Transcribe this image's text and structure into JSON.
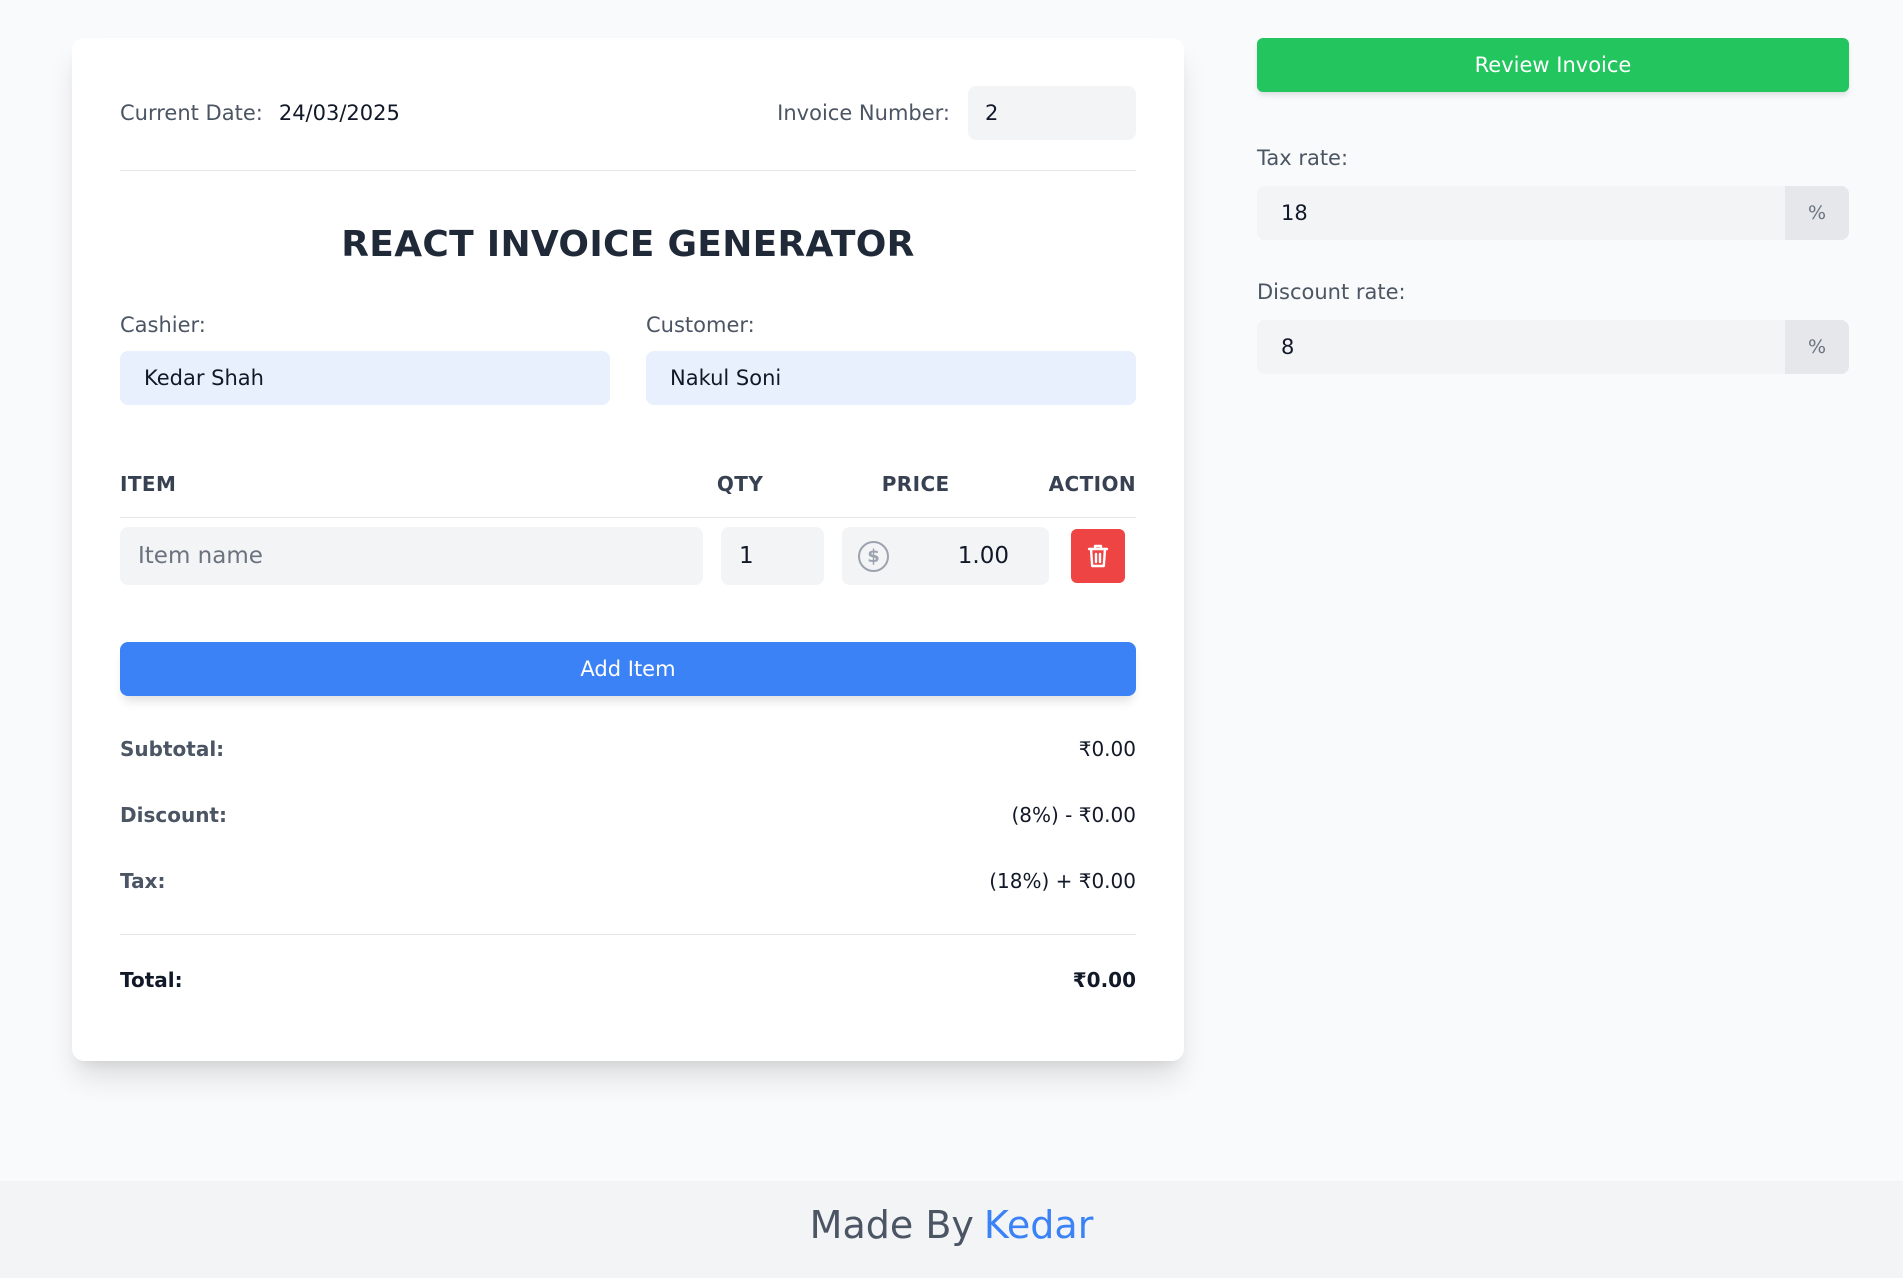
{
  "invoice": {
    "current_date_label": "Current Date:",
    "current_date": "24/03/2025",
    "invoice_number_label": "Invoice Number:",
    "invoice_number": "2",
    "title": "REACT INVOICE GENERATOR",
    "cashier_label": "Cashier:",
    "cashier": "Kedar Shah",
    "customer_label": "Customer:",
    "customer": "Nakul Soni"
  },
  "table": {
    "headers": [
      "ITEM",
      "QTY",
      "PRICE",
      "ACTION"
    ],
    "rows": [
      {
        "item_placeholder": "Item name",
        "qty": "1",
        "price": "1.00"
      }
    ],
    "add_item_label": "Add Item"
  },
  "summary": {
    "subtotal_label": "Subtotal:",
    "subtotal": "₹0.00",
    "discount_label": "Discount:",
    "discount": "(8%) - ₹0.00",
    "tax_label": "Tax:",
    "tax": "(18%) + ₹0.00",
    "total_label": "Total:",
    "total": "₹0.00"
  },
  "sidebar": {
    "review_label": "Review Invoice",
    "tax_rate_label": "Tax rate:",
    "tax_rate": "18",
    "discount_rate_label": "Discount rate:",
    "discount_rate": "8",
    "percent_symbol": "%"
  },
  "footer": {
    "made_by": "Made By",
    "author": "Kedar"
  },
  "icons": {
    "price_currency": "dollar-icon",
    "delete": "trash-icon"
  },
  "colors": {
    "primary_blue": "#3b82f6",
    "success_green": "#22c55e",
    "danger_red": "#ef4444"
  }
}
